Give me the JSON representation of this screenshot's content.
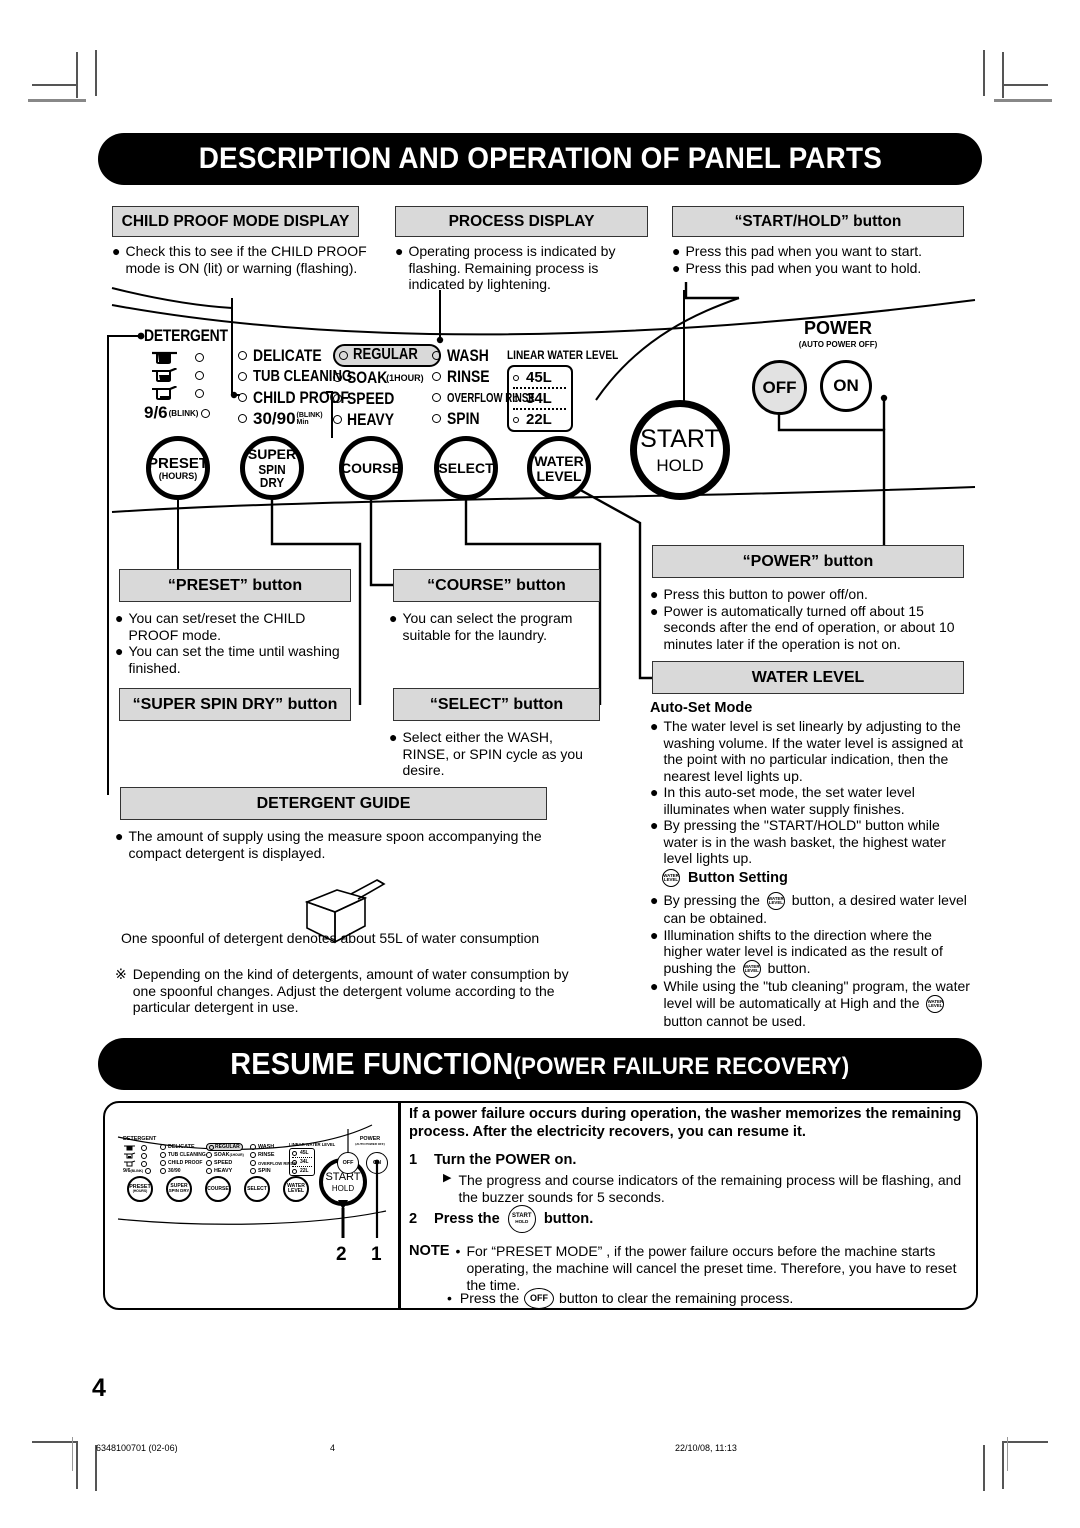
{
  "sections": {
    "banner1": "DESCRIPTION AND OPERATION OF PANEL PARTS",
    "banner2_main": "RESUME FUNCTION",
    "banner2_sub": "(POWER FAILURE RECOVERY)"
  },
  "callouts": {
    "child_proof": {
      "title": "CHILD PROOF MODE DISPLAY",
      "bullets": [
        "Check this to see if the CHILD PROOF mode is ON (lit) or warning (flashing)."
      ]
    },
    "process_display": {
      "title": "PROCESS DISPLAY",
      "bullets": [
        "Operating process is indicated by flashing. Remaining process is indicated by lightening."
      ]
    },
    "start_hold": {
      "title": "“START/HOLD” button",
      "bullets": [
        "Press this pad when you want to start.",
        "Press this pad when you want to hold."
      ]
    },
    "preset": {
      "title": "“PRESET” button",
      "bullets": [
        "You can set/reset the CHILD PROOF mode.",
        "You can set the time until washing finished."
      ]
    },
    "course": {
      "title": "“COURSE” button",
      "bullets": [
        "You can select the program suitable for the laundry."
      ]
    },
    "super_spin_dry": {
      "title": "“SUPER SPIN DRY” button",
      "bullets": []
    },
    "select": {
      "title": "“SELECT” button",
      "bullets": [
        "Select either the WASH, RINSE, or SPIN cycle as you desire."
      ]
    },
    "power": {
      "title": "“POWER” button",
      "bullets": [
        "Press this button to power off/on.",
        "Power is automatically turned off about 15 seconds after the end of operation, or about 10 minutes later if the operation is not on."
      ]
    },
    "water_level": {
      "title": "WATER LEVEL",
      "subhead_auto": "Auto-Set Mode",
      "auto_bullets": [
        "The water level is set linearly by adjusting to the washing volume. If the water level is assigned at the point with no particular indication, then the nearest level lights up.",
        "In this auto-set mode, the set water level illuminates when water supply finishes.",
        "By pressing the \"START/HOLD\" button while water is in the wash basket, the highest water level lights up."
      ],
      "subhead_button": "Button Setting",
      "button_bullets": [
        {
          "pre": "By pressing the",
          "post": "button, a desired water level can be obtained."
        },
        {
          "pre": "Illumination shifts to the direction where the higher water level is indicated as the result of pushing the",
          "post": "button."
        },
        {
          "pre": "While using the \"tub cleaning\" program, the water level will be automatically at High and the",
          "post": "button cannot be used."
        }
      ]
    },
    "detergent_guide": {
      "title": "DETERGENT GUIDE",
      "bullets": [
        "The amount of supply using the measure spoon accompanying the compact detergent is displayed."
      ],
      "caption": "One spoonful of detergent denotes about 55L of water consumption",
      "note_mark": "※",
      "note": "Depending on the kind of detergents, amount of water consumption by one spoonful changes. Adjust the detergent volume according to the particular detergent in use."
    }
  },
  "panel": {
    "detergent_label": "DETERGENT",
    "detergent_blink": "9/6",
    "detergent_blink_sub": "(BLINK)",
    "col_course": [
      {
        "label": "DELICATE"
      },
      {
        "label": "TUB CLEANING"
      },
      {
        "label": "CHILD PROOF"
      },
      {
        "label": "30/90",
        "sup": "(BLINK)",
        "sup2": "Min"
      }
    ],
    "col_course2": [
      {
        "label": "REGULAR",
        "highlight": true
      },
      {
        "label": "SOAK",
        "sub": "(1HOUR)"
      },
      {
        "label": "SPEED"
      },
      {
        "label": "HEAVY"
      }
    ],
    "col_process": [
      {
        "label": "WASH"
      },
      {
        "label": "RINSE"
      },
      {
        "label": "OVERFLOW RINSE",
        "narrow": true
      },
      {
        "label": "SPIN"
      }
    ],
    "water_level_title": "LINEAR WATER LEVEL",
    "water_levels": [
      "45L",
      "34L",
      "22L"
    ],
    "buttons": [
      {
        "line1": "PRESET",
        "line2": "(HOURS)"
      },
      {
        "line1": "SUPER",
        "line2": "SPIN DRY"
      },
      {
        "line1": "COURSE",
        "line2": ""
      },
      {
        "line1": "SELECT",
        "line2": ""
      },
      {
        "line1": "WATER",
        "line2": "LEVEL"
      }
    ],
    "start_button": {
      "line1": "START",
      "line2": "HOLD"
    },
    "power_label": "POWER",
    "power_sub": "(AUTO POWER OFF)",
    "power_off": "OFF",
    "power_on": "ON"
  },
  "resume": {
    "intro": "If a power failure occurs during operation, the washer memorizes the remaining process. After the electricity recovers, you can resume it.",
    "step1_num": "1",
    "step1": "Turn the POWER on.",
    "step1_sub": "The progress and course indicators of the remaining process will be flashing, and the buzzer sounds for 5 seconds.",
    "step2_num": "2",
    "step2_pre": "Press the",
    "step2_post": "button.",
    "step2_icon_l1": "START",
    "step2_icon_l2": "HOLD",
    "note_label": "NOTE",
    "note1": "For “PRESET MODE” , if the power failure occurs before the machine starts operating, the machine will cancel the preset time. Therefore, you have to reset the time.",
    "note2_pre": "Press the",
    "note2_post": "button to clear the remaining process.",
    "note2_icon": "OFF",
    "marker1": "1",
    "marker2": "2"
  },
  "footer": {
    "page_number": "4",
    "doc_code": "6348100701 (02-06)",
    "folio": "4",
    "timestamp": "22/10/08, 11:13"
  },
  "colors": {
    "banner_bg": "#000000",
    "header_box_bg": "#d9d9d9",
    "text": "#000000"
  }
}
